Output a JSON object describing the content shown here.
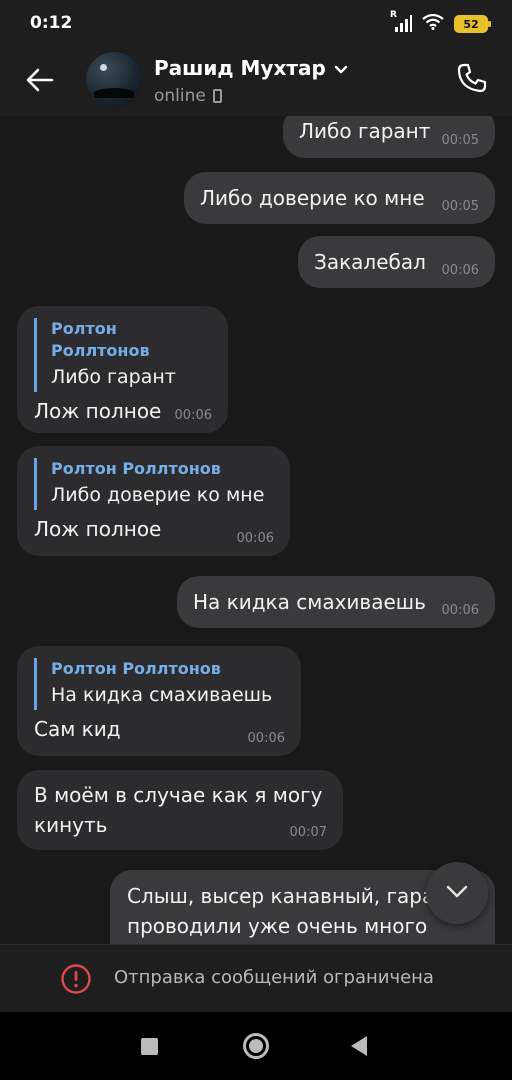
{
  "status_bar": {
    "time": "0:12",
    "signal_label": "R",
    "battery": "52",
    "battery_color": "#e7c12b"
  },
  "header": {
    "back_icon": "arrow-left-icon",
    "contact_name": "Рашид Мухтар",
    "dropdown_icon": "chevron-down-icon",
    "status": "online",
    "device_icon": "mobile-phone-icon",
    "call_icon": "phone-icon"
  },
  "messages": [
    {
      "direction": "out",
      "text": "Либо гарант",
      "time": "00:05"
    },
    {
      "direction": "out",
      "text": "Либо доверие ко мне",
      "time": "00:05"
    },
    {
      "direction": "out",
      "text": "Закалебал",
      "time": "00:06"
    },
    {
      "direction": "in",
      "reply_author": "Ролтон Роллтонов",
      "reply_text": "Либо гарант",
      "text": "Лож полное",
      "time": "00:06"
    },
    {
      "direction": "in",
      "reply_author": "Ролтон Роллтонов",
      "reply_text": "Либо доверие ко мне",
      "text": "Лож полное",
      "time": "00:06"
    },
    {
      "direction": "out",
      "text": "На кидка смахиваешь",
      "time": "00:06"
    },
    {
      "direction": "in",
      "reply_author": "Ролтон Роллтонов",
      "reply_text": "На кидка смахиваешь",
      "text": "Сам кид",
      "time": "00:06"
    },
    {
      "direction": "in",
      "text": "В моём в случае как я могу\nкинуть",
      "time": "00:07"
    },
    {
      "direction": "out",
      "text": "Слыш, высер канавный, гара\nпроводили уже очень много"
    }
  ],
  "scroll_down_icon": "chevron-down-icon",
  "restricted": {
    "icon": "exclamation-circle-icon",
    "text": "Отправка сообщений ограничена",
    "icon_color": "#e0474c"
  },
  "nav_bar": {
    "recents_icon": "square-icon",
    "home_icon": "circle-icon",
    "back_icon": "triangle-back-icon"
  },
  "colors": {
    "background": "#19191a",
    "outgoing_bubble": "#3a3a3c",
    "incoming_bubble": "#2c2c2e",
    "reply_accent": "#78aee8"
  }
}
